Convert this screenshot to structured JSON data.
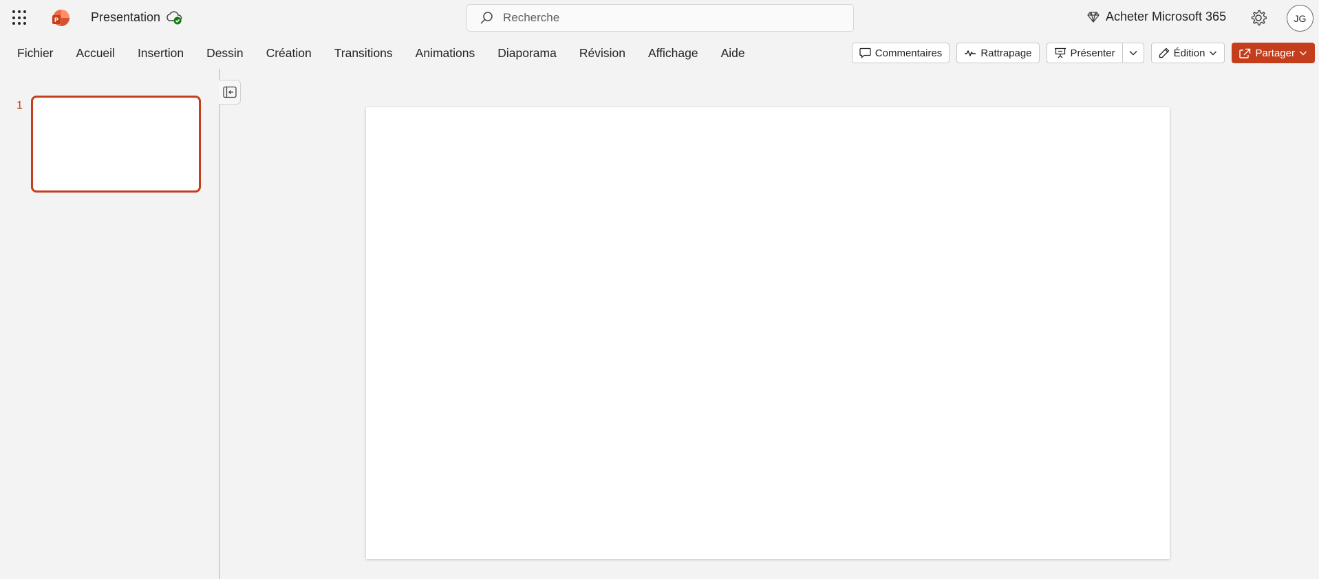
{
  "app": {
    "document_title": "Presentation",
    "accent_color": "#c43e1c"
  },
  "search": {
    "placeholder": "Recherche"
  },
  "header": {
    "buy_label": "Acheter Microsoft 365",
    "avatar_initials": "JG"
  },
  "ribbon": {
    "tabs": [
      {
        "label": "Fichier"
      },
      {
        "label": "Accueil"
      },
      {
        "label": "Insertion"
      },
      {
        "label": "Dessin"
      },
      {
        "label": "Création"
      },
      {
        "label": "Transitions"
      },
      {
        "label": "Animations"
      },
      {
        "label": "Diaporama"
      },
      {
        "label": "Révision"
      },
      {
        "label": "Affichage"
      },
      {
        "label": "Aide"
      }
    ],
    "actions": {
      "comments": "Commentaires",
      "catchup": "Rattrapage",
      "present": "Présenter",
      "editing": "Édition",
      "share": "Partager"
    }
  },
  "slides": [
    {
      "number": "1"
    }
  ],
  "icons": {
    "waffle": "app-launcher-icon",
    "logo": "powerpoint-logo-icon",
    "cloud": "cloud-saved-icon",
    "search": "search-icon",
    "diamond": "diamond-icon",
    "gear": "gear-icon",
    "comment": "comment-icon",
    "catchup": "pulse-icon",
    "present": "presenter-icon",
    "pencil": "pencil-icon",
    "share": "share-icon",
    "collapse": "collapse-pane-icon"
  }
}
